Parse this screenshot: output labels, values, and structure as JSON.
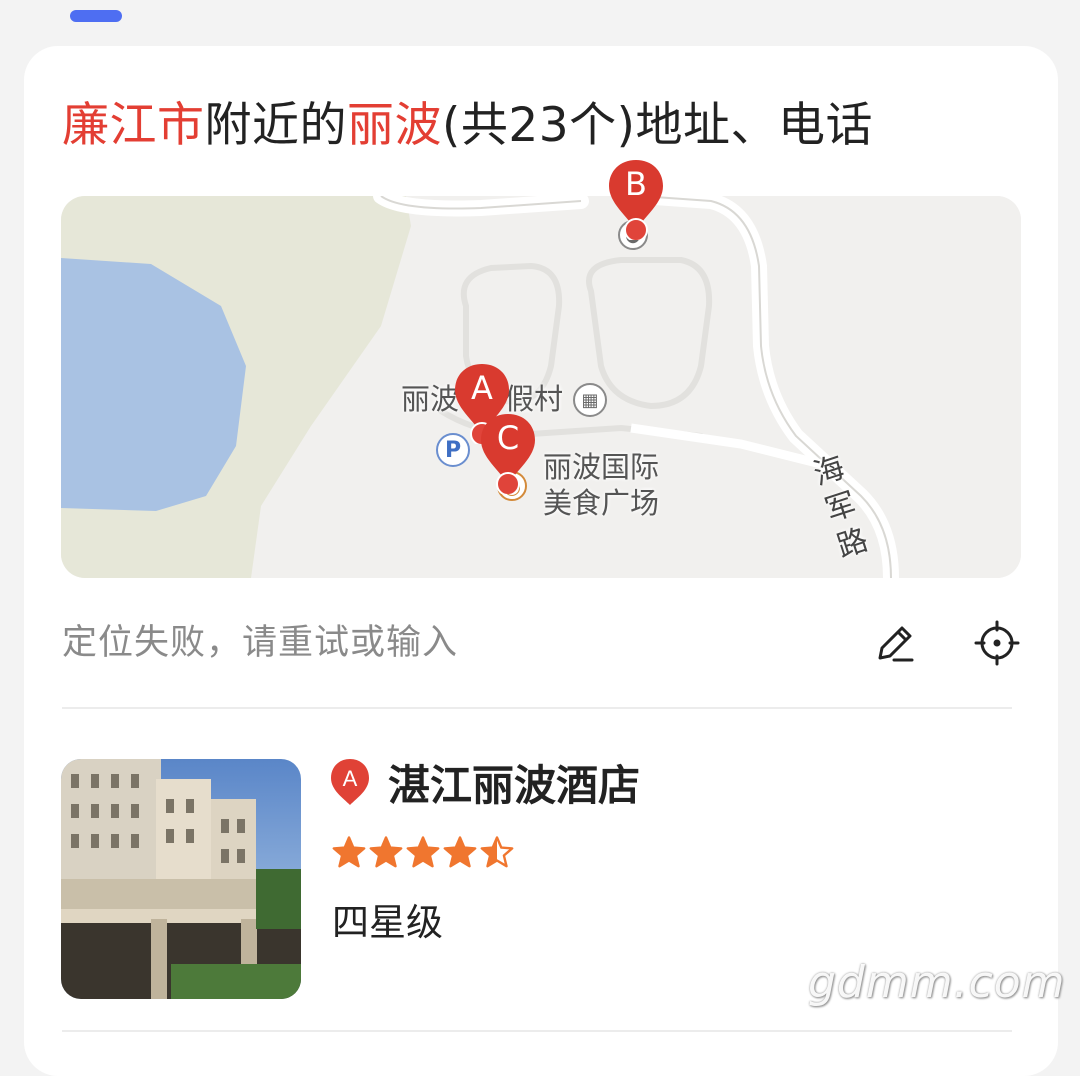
{
  "title": {
    "city": "廉江市",
    "text1": "附近的",
    "keyword": "丽波",
    "text2": "(共23个)地址、电话"
  },
  "map": {
    "labels": {
      "resort": "丽波",
      "resort_suffix": "假村",
      "food_plaza_line1": "丽波国际",
      "food_plaza_line2": "美食广场",
      "road": "海军路"
    },
    "markers": [
      "A",
      "B",
      "C"
    ],
    "parking_glyph": "P",
    "marker_color": "#d93a2f",
    "water_color": "#a9c2e3",
    "land_color": "#e6e7d8"
  },
  "location": {
    "text": "定位失败，请重试或输入",
    "edit_icon": "pencil-icon",
    "locate_icon": "crosshair-icon"
  },
  "result": {
    "marker": "A",
    "name": "湛江丽波酒店",
    "rating": 4.5,
    "rating_max": 5,
    "star_color": "#f0762f",
    "level": "四星级"
  },
  "watermark": "gdmm.com"
}
